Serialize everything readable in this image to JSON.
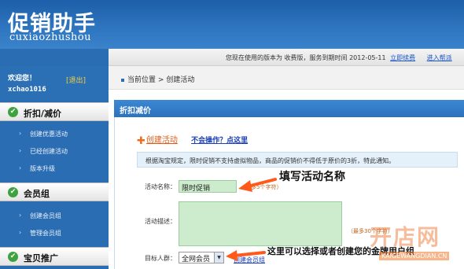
{
  "header": {
    "logo_cn": "促销助手",
    "logo_en": "cuxiaozhushou"
  },
  "infobar": {
    "version_text": "您现在使用的版本为 收费版，服务到期时间 2012-05-11",
    "renew_link": "立即续费",
    "contact_link": "进入帮派"
  },
  "sidebar": {
    "welcome": "欢迎您！",
    "logout": "[退出]",
    "username": "xchao1016",
    "sections": [
      {
        "label": "折扣/减价",
        "items": [
          "创建优惠活动",
          "已经创建活动",
          "版本升级"
        ]
      },
      {
        "label": "会员组",
        "items": [
          "创建会员组",
          "管理会员组"
        ]
      },
      {
        "label": "宝贝推广",
        "items": []
      }
    ]
  },
  "breadcrumb": {
    "current_position": "当前位置",
    "separator": ">",
    "page": "创建活动"
  },
  "panel": {
    "title": "折扣减价",
    "create_link": "创建活动",
    "help_link": "不会操作？点这里",
    "notice": "根据淘宝规定，限时促销不支持虚拟物品，商品的促销价不得低于原价的3折，特此通知。"
  },
  "form": {
    "name_label": "活动名称：",
    "name_value": "限时促销",
    "name_hint": "（最多5个字符）",
    "desc_label": "活动描述：",
    "desc_value": "",
    "desc_hint": "（最多30个字符）",
    "group_label": "目标人群：",
    "group_value": "全网会员",
    "create_group_link": "创建会员组"
  },
  "annotations": {
    "fill_name": "填写活动名称",
    "group_tip": "这里可以选择或者创建您的金牌用户组"
  },
  "watermark": {
    "cn": "开店网",
    "en": "KAIGEWANGDIAN.CN"
  },
  "colors": {
    "header_blue": "#1d5fa8",
    "sidebar_blue": "#2a6db3",
    "input_green": "#cdeccd",
    "arrow_orange": "#ff5a1a",
    "check_green": "#3ea33e"
  }
}
